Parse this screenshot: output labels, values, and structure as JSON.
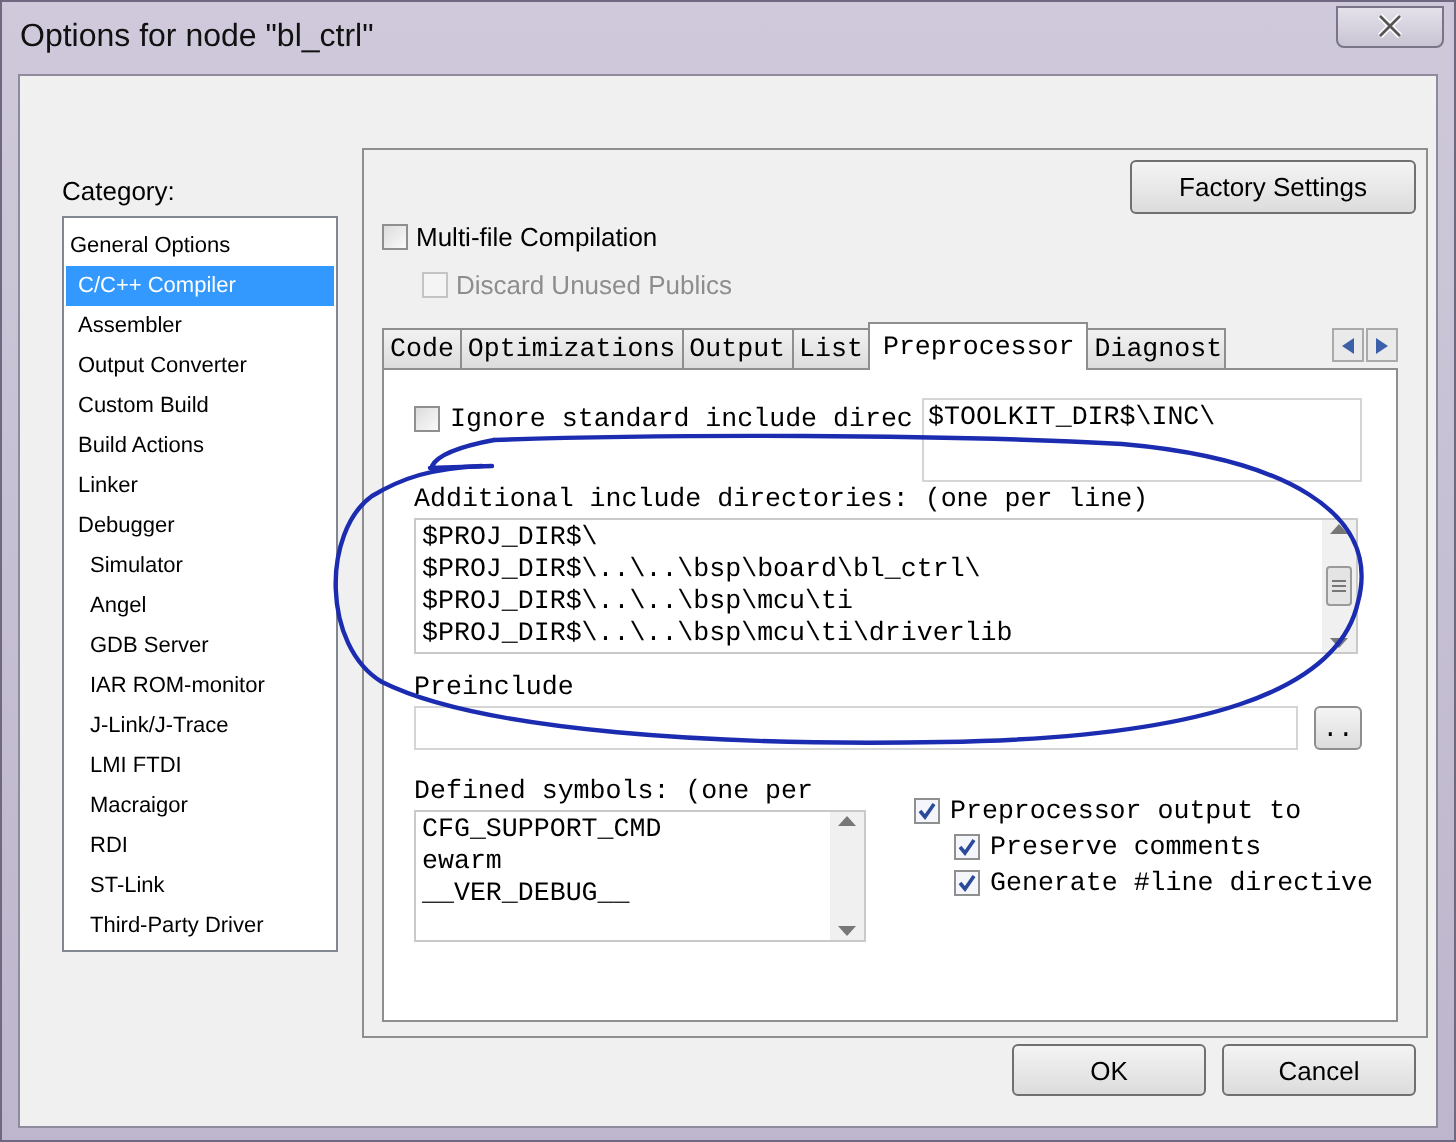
{
  "window": {
    "title": "Options for node \"bl_ctrl\""
  },
  "category": {
    "label": "Category:",
    "items": [
      {
        "label": "General Options",
        "selected": false
      },
      {
        "label": "C/C++ Compiler",
        "selected": true
      },
      {
        "label": "Assembler",
        "selected": false
      },
      {
        "label": "Output Converter",
        "selected": false
      },
      {
        "label": "Custom Build",
        "selected": false
      },
      {
        "label": "Build Actions",
        "selected": false
      },
      {
        "label": "Linker",
        "selected": false
      },
      {
        "label": "Debugger",
        "selected": false,
        "children": [
          {
            "label": "Simulator",
            "selected": false
          },
          {
            "label": "Angel",
            "selected": false
          },
          {
            "label": "GDB Server",
            "selected": false
          },
          {
            "label": "IAR ROM-monitor",
            "selected": false
          },
          {
            "label": "J-Link/J-Trace",
            "selected": false
          },
          {
            "label": "LMI FTDI",
            "selected": false
          },
          {
            "label": "Macraigor",
            "selected": false
          },
          {
            "label": "RDI",
            "selected": false
          },
          {
            "label": "ST-Link",
            "selected": false
          },
          {
            "label": "Third-Party Driver",
            "selected": false
          }
        ]
      }
    ]
  },
  "factory_settings_button": "Factory Settings",
  "options": [
    {
      "label": "Multi-file Compilation",
      "checked": false,
      "disabled": false
    },
    {
      "label": "Discard Unused Publics",
      "checked": false,
      "disabled": true
    }
  ],
  "tabs": [
    {
      "label": "Code",
      "selected": false
    },
    {
      "label": "Optimizations",
      "selected": false
    },
    {
      "label": "Output",
      "selected": false
    },
    {
      "label": "List",
      "selected": false
    },
    {
      "label": "Preprocessor",
      "selected": true
    },
    {
      "label": "Diagnost",
      "selected": false
    }
  ],
  "preprocessor": {
    "ignore_standard": {
      "label": "Ignore standard include direc",
      "checked": false
    },
    "standard_include_dir": "$TOOLKIT_DIR$\\INC\\",
    "additional_include": {
      "label": "Additional include directories: (one per line)",
      "lines": [
        "$PROJ_DIR$\\",
        "$PROJ_DIR$\\..\\..\\bsp\\board\\bl_ctrl\\",
        "$PROJ_DIR$\\..\\..\\bsp\\mcu\\ti",
        "$PROJ_DIR$\\..\\..\\bsp\\mcu\\ti\\driverlib"
      ]
    },
    "preinclude": {
      "label": "Preinclude",
      "browse_button": ".."
    },
    "defined_symbols": {
      "label": "Defined symbols: (one per",
      "lines": [
        "CFG_SUPPORT_CMD",
        "ewarm",
        "__VER_DEBUG__"
      ]
    },
    "output_options": [
      {
        "label": "Preprocessor output to",
        "checked": true,
        "children": [
          {
            "label": "Preserve comments",
            "checked": true
          },
          {
            "label": "Generate #line directive",
            "checked": true
          }
        ]
      }
    ]
  },
  "buttons": [
    "OK",
    "Cancel"
  ]
}
